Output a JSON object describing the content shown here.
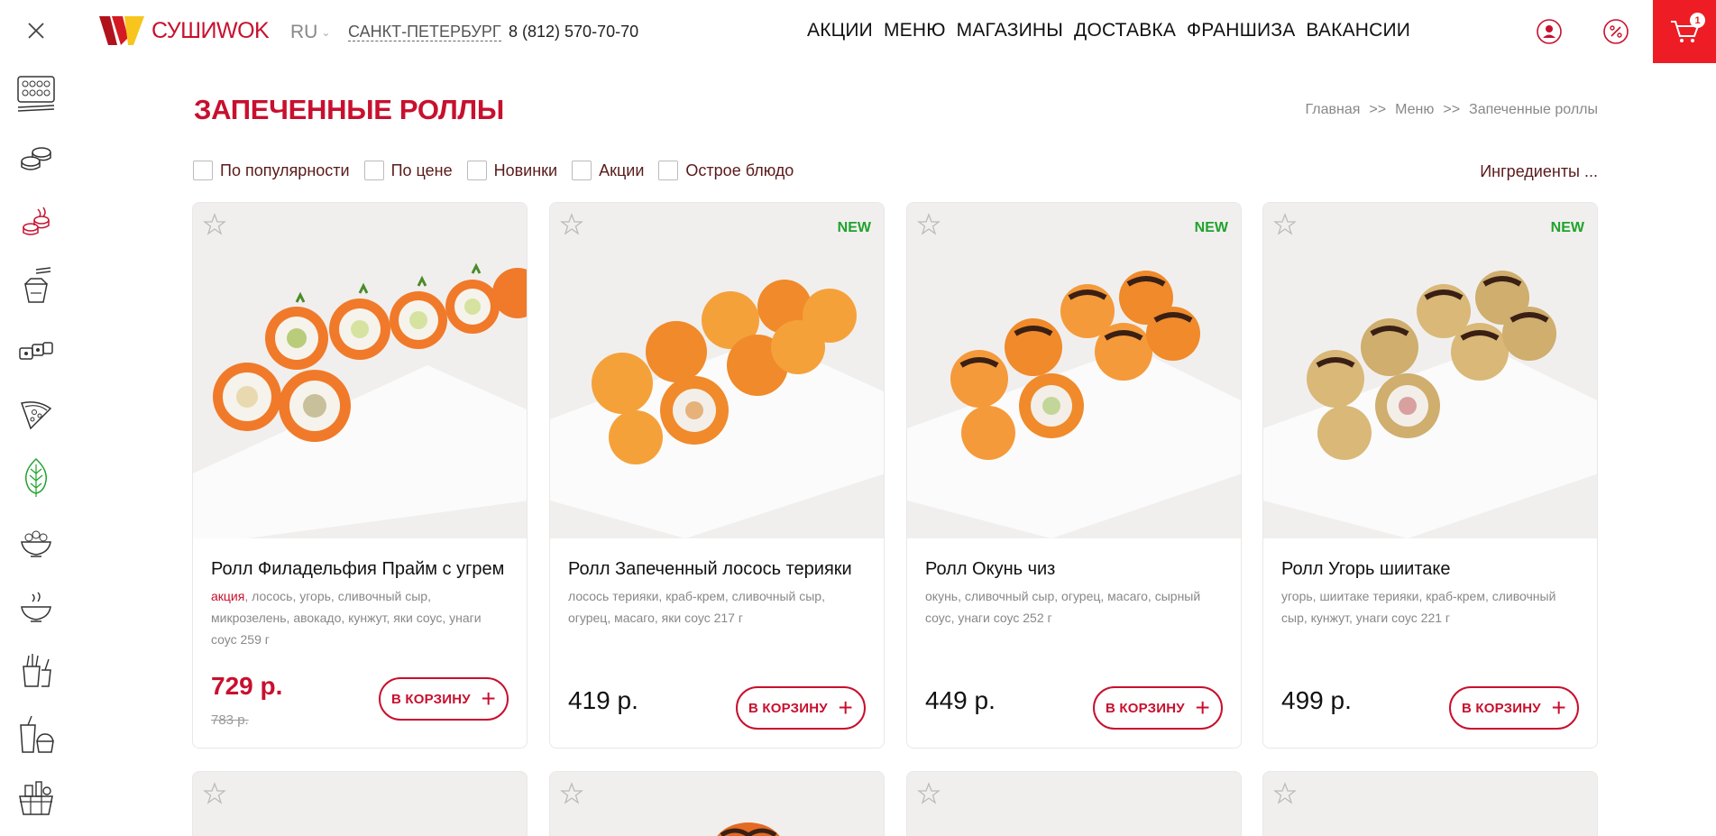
{
  "header": {
    "logo_text": "СУШИWOK",
    "lang": "RU",
    "city": "САНКТ-ПЕТЕРБУРГ",
    "phone": "8 (812) 570-70-70",
    "nav": [
      "АКЦИИ",
      "МЕНЮ",
      "МАГАЗИНЫ",
      "ДОСТАВКА",
      "ФРАНШИЗА",
      "ВАКАНСИИ"
    ],
    "cart_count": "1"
  },
  "sidebar": {
    "items": [
      {
        "icon": "sets-icon"
      },
      {
        "icon": "sushi-icon"
      },
      {
        "icon": "baked-rolls-icon",
        "active": true
      },
      {
        "icon": "wok-icon"
      },
      {
        "icon": "rolls-icon"
      },
      {
        "icon": "pizza-icon"
      },
      {
        "icon": "vegan-icon"
      },
      {
        "icon": "salad-icon"
      },
      {
        "icon": "soup-icon"
      },
      {
        "icon": "snacks-icon"
      },
      {
        "icon": "desserts-drinks-icon"
      },
      {
        "icon": "grocery-basket-icon"
      }
    ]
  },
  "page": {
    "title": "ЗАПЕЧЕННЫЕ РОЛЛЫ",
    "breadcrumb": [
      "Главная",
      "Меню",
      "Запеченные роллы"
    ],
    "breadcrumb_sep": ">>"
  },
  "filters": [
    "По популярности",
    "По цене",
    "Новинки",
    "Акции",
    "Острое блюдо"
  ],
  "ingredients_label": "Ингредиенты ...",
  "products": [
    {
      "name": "Ролл Филадельфия Прайм с угрем",
      "promo": "акция",
      "desc": ", лосось, угорь, сливочный сыр, микрозелень, авокадо, кунжут, яки соус, унаги соус 259 г",
      "price": "729 р.",
      "old_price": "783 р.",
      "badge": "",
      "cart_label": "В КОРЗИНУ"
    },
    {
      "name": "Ролл Запеченный лосось терияки",
      "promo": "",
      "desc": "лосось терияки, краб-крем, сливочный сыр, огурец, масаго, яки соус 217 г",
      "price": "419 р.",
      "old_price": "",
      "badge": "NEW",
      "cart_label": "В КОРЗИНУ"
    },
    {
      "name": "Ролл Окунь чиз",
      "promo": "",
      "desc": "окунь, сливочный сыр, огурец, масаго, сырный соус, унаги соус 252 г",
      "price": "449 р.",
      "old_price": "",
      "badge": "NEW",
      "cart_label": "В КОРЗИНУ"
    },
    {
      "name": "Ролл Угорь шиитаке",
      "promo": "",
      "desc": "угорь, шиитаке терияки, краб-крем, сливочный сыр, кунжут, унаги соус 221 г",
      "price": "499 р.",
      "old_price": "",
      "badge": "NEW",
      "cart_label": "В КОРЗИНУ"
    }
  ],
  "colors": {
    "brand_red": "#c8102e",
    "cart_red": "#ee1c25",
    "new_green": "#1fa32c"
  }
}
